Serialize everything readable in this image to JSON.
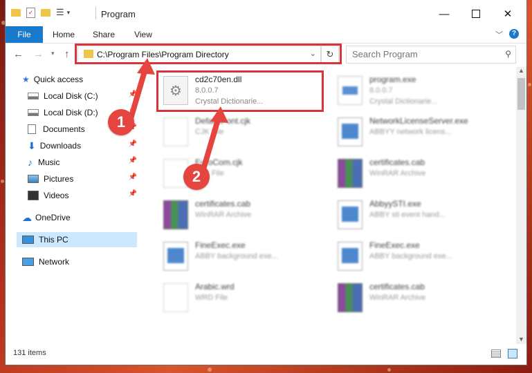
{
  "window": {
    "title": "Program"
  },
  "ribbon": {
    "tabs": [
      "File",
      "Home",
      "Share",
      "View"
    ]
  },
  "address": {
    "path": "C:\\Program Files\\Program Directory"
  },
  "search": {
    "placeholder": "Search Program"
  },
  "nav": {
    "items": [
      {
        "label": "Quick access",
        "icon": "star-icon"
      },
      {
        "label": "Local Disk (C:)",
        "icon": "drive-icon"
      },
      {
        "label": "Local Disk (D:)",
        "icon": "drive-icon"
      },
      {
        "label": "Documents",
        "icon": "documents-icon"
      },
      {
        "label": "Downloads",
        "icon": "download-icon"
      },
      {
        "label": "Music",
        "icon": "music-icon"
      },
      {
        "label": "Pictures",
        "icon": "pictures-icon"
      },
      {
        "label": "Videos",
        "icon": "videos-icon"
      },
      {
        "label": "OneDrive",
        "icon": "cloud-icon"
      },
      {
        "label": "This PC",
        "icon": "computer-icon"
      },
      {
        "label": "Network",
        "icon": "network-icon"
      }
    ]
  },
  "files": [
    {
      "name": "cd2c70en.dll",
      "line2": "8.0.0.7",
      "line3": "Crystal Dictionarie...",
      "icon": "dll-gear-icon"
    },
    {
      "name": "program.exe",
      "line2": "8.0.0.7",
      "line3": "Crystal Dictionarie...",
      "icon": "exe-icon"
    },
    {
      "name": "DefaultFont.cjk",
      "line2": "CJK File",
      "line3": "",
      "icon": "blank-file-icon"
    },
    {
      "name": "NetworkLicenseServer.exe",
      "line2": "ABBYY network licens...",
      "line3": "",
      "icon": "app-window-icon"
    },
    {
      "name": "EuroCom.cjk",
      "line2": "CJK File",
      "line3": "",
      "icon": "blank-file-icon"
    },
    {
      "name": "certificates.cab",
      "line2": "WinRAR Archive",
      "line3": "",
      "icon": "winrar-icon"
    },
    {
      "name": "certificates.cab",
      "line2": "WinRAR Archive",
      "line3": "",
      "icon": "winrar-icon"
    },
    {
      "name": "AbbyySTI.exe",
      "line2": "ABBY sti event hand...",
      "line3": "",
      "icon": "app-window-icon"
    },
    {
      "name": "FineExec.exe",
      "line2": "ABBY background exe...",
      "line3": "",
      "icon": "app-window-icon"
    },
    {
      "name": "FineExec.exe",
      "line2": "ABBY background exe...",
      "line3": "",
      "icon": "app-window-icon"
    },
    {
      "name": "Arabic.wrd",
      "line2": "WRD File",
      "line3": "",
      "icon": "blank-file-icon"
    },
    {
      "name": "certificates.cab",
      "line2": "WinRAR Archive",
      "line3": "",
      "icon": "winrar-icon"
    }
  ],
  "status": {
    "count": "131 items"
  },
  "callouts": [
    "1",
    "2"
  ],
  "colors": {
    "accent": "#1979ca",
    "highlight": "#d9343a",
    "selected": "#cce8ff",
    "callout": "#e5443f"
  }
}
